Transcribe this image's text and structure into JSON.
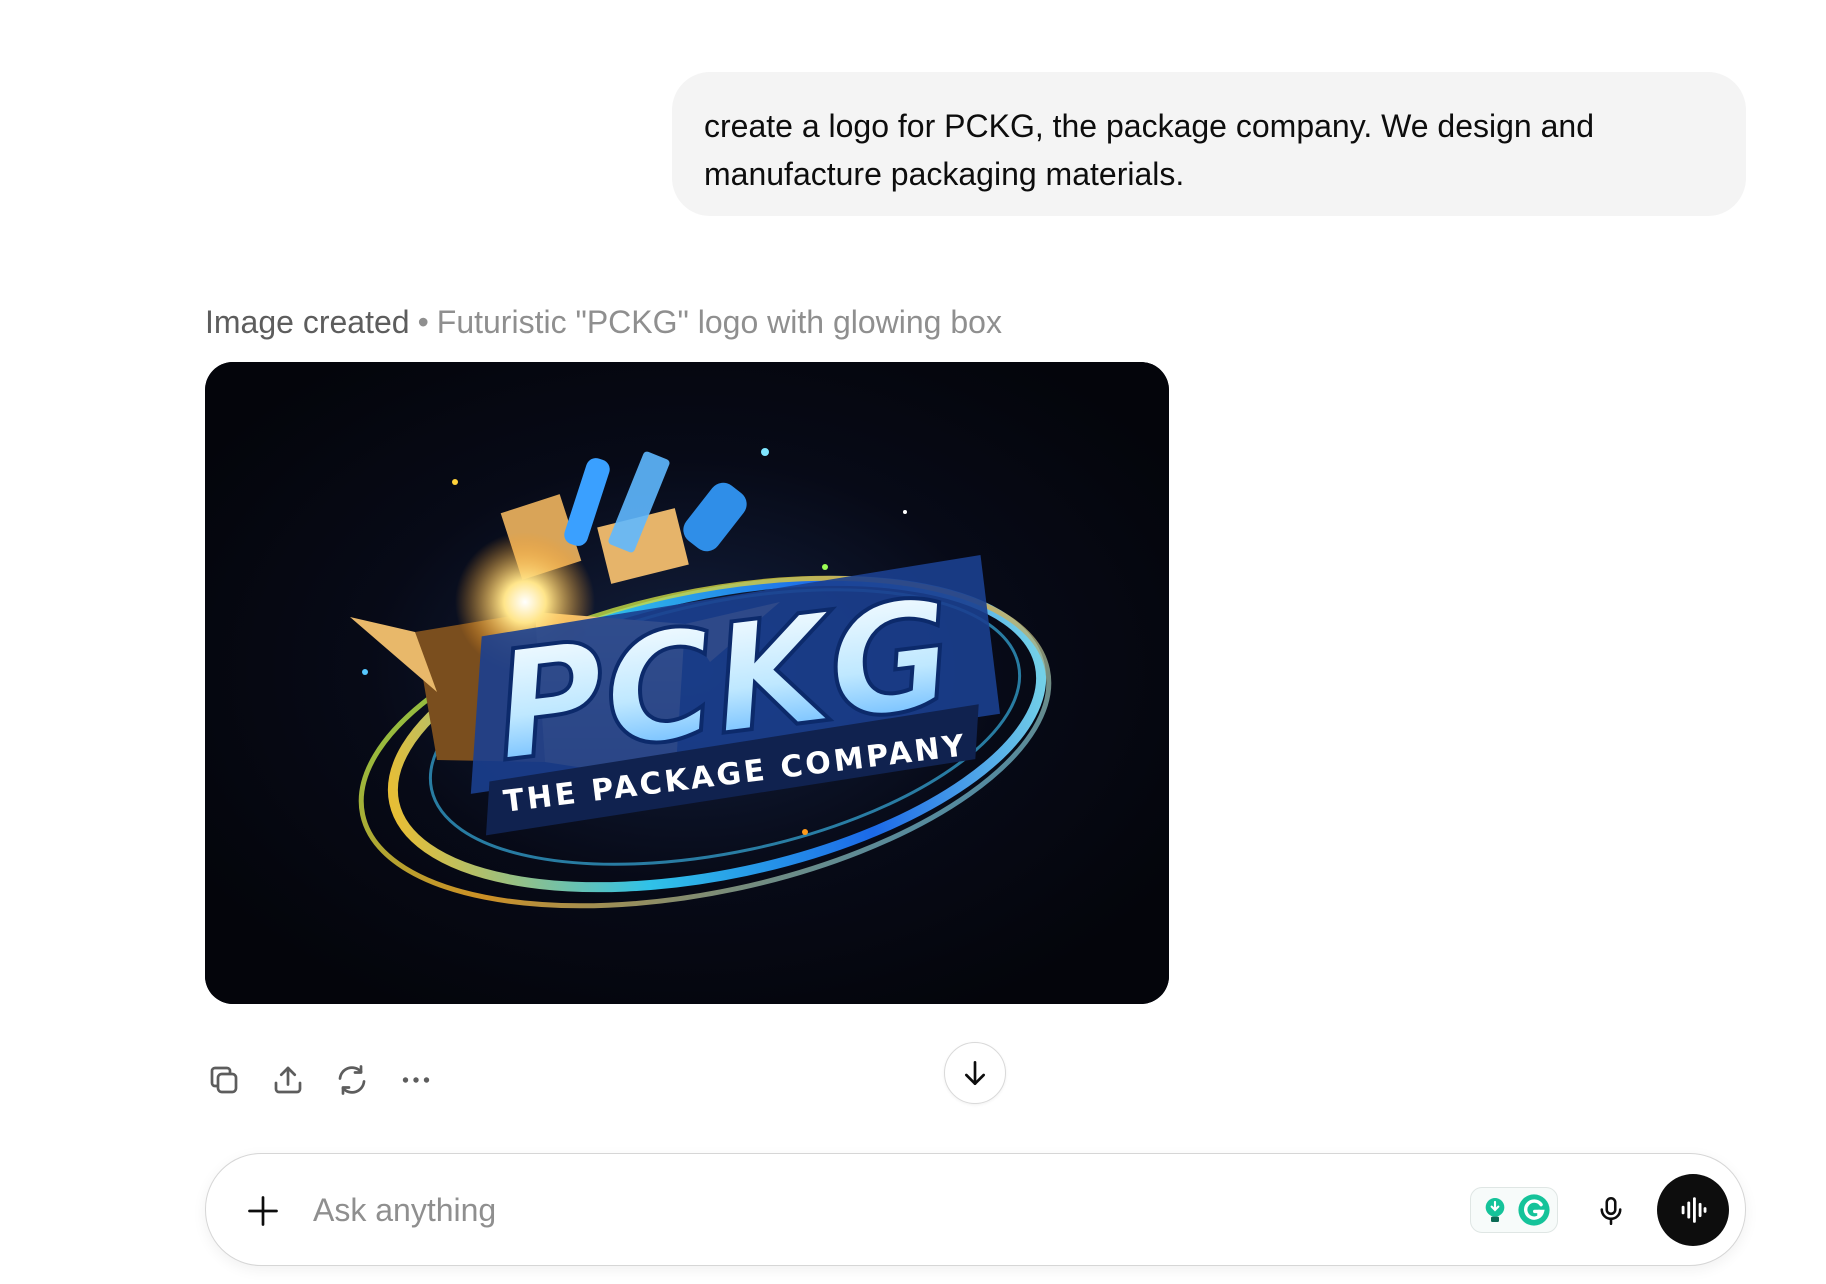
{
  "user_message": {
    "lines": [
      "create a logo for PCKG, the package company. We design and",
      "manufacture packaging materials."
    ]
  },
  "assistant": {
    "status": "Image created",
    "separator": "•",
    "description": "Futuristic \"PCKG\" logo with glowing box",
    "image": {
      "logo_text": "PCKG",
      "tagline": "THE PACKAGE COMPANY"
    }
  },
  "actions": {
    "copy_icon": "copy-icon",
    "share_icon": "share-icon",
    "regenerate_icon": "regenerate-icon",
    "more_icon": "more-icon"
  },
  "scroll_down_icon": "arrow-down-icon",
  "composer": {
    "placeholder": "Ask anything",
    "plus_icon": "plus-icon",
    "extension_icons": [
      "lightbulb-extension-icon",
      "grammarly-icon"
    ],
    "mic_icon": "microphone-icon",
    "voice_icon": "voice-mode-icon"
  },
  "colors": {
    "bubble": "#f4f4f4",
    "text_primary": "#0d0d0d",
    "text_secondary": "#8f8f8f",
    "voice_button": "#0d0d0d",
    "grammarly": "#15c39a"
  }
}
